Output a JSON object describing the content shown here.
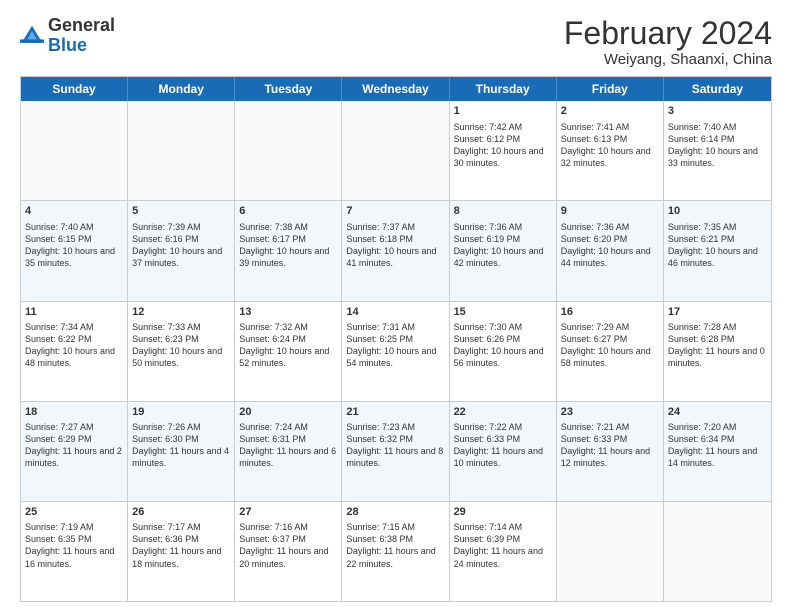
{
  "header": {
    "logo": {
      "general": "General",
      "blue": "Blue"
    },
    "title": "February 2024",
    "location": "Weiyang, Shaanxi, China"
  },
  "days_of_week": [
    "Sunday",
    "Monday",
    "Tuesday",
    "Wednesday",
    "Thursday",
    "Friday",
    "Saturday"
  ],
  "weeks": [
    {
      "alt": false,
      "cells": [
        {
          "day": "",
          "info": ""
        },
        {
          "day": "",
          "info": ""
        },
        {
          "day": "",
          "info": ""
        },
        {
          "day": "",
          "info": ""
        },
        {
          "day": "1",
          "info": "Sunrise: 7:42 AM\nSunset: 6:12 PM\nDaylight: 10 hours and 30 minutes."
        },
        {
          "day": "2",
          "info": "Sunrise: 7:41 AM\nSunset: 6:13 PM\nDaylight: 10 hours and 32 minutes."
        },
        {
          "day": "3",
          "info": "Sunrise: 7:40 AM\nSunset: 6:14 PM\nDaylight: 10 hours and 33 minutes."
        }
      ]
    },
    {
      "alt": true,
      "cells": [
        {
          "day": "4",
          "info": "Sunrise: 7:40 AM\nSunset: 6:15 PM\nDaylight: 10 hours and 35 minutes."
        },
        {
          "day": "5",
          "info": "Sunrise: 7:39 AM\nSunset: 6:16 PM\nDaylight: 10 hours and 37 minutes."
        },
        {
          "day": "6",
          "info": "Sunrise: 7:38 AM\nSunset: 6:17 PM\nDaylight: 10 hours and 39 minutes."
        },
        {
          "day": "7",
          "info": "Sunrise: 7:37 AM\nSunset: 6:18 PM\nDaylight: 10 hours and 41 minutes."
        },
        {
          "day": "8",
          "info": "Sunrise: 7:36 AM\nSunset: 6:19 PM\nDaylight: 10 hours and 42 minutes."
        },
        {
          "day": "9",
          "info": "Sunrise: 7:36 AM\nSunset: 6:20 PM\nDaylight: 10 hours and 44 minutes."
        },
        {
          "day": "10",
          "info": "Sunrise: 7:35 AM\nSunset: 6:21 PM\nDaylight: 10 hours and 46 minutes."
        }
      ]
    },
    {
      "alt": false,
      "cells": [
        {
          "day": "11",
          "info": "Sunrise: 7:34 AM\nSunset: 6:22 PM\nDaylight: 10 hours and 48 minutes."
        },
        {
          "day": "12",
          "info": "Sunrise: 7:33 AM\nSunset: 6:23 PM\nDaylight: 10 hours and 50 minutes."
        },
        {
          "day": "13",
          "info": "Sunrise: 7:32 AM\nSunset: 6:24 PM\nDaylight: 10 hours and 52 minutes."
        },
        {
          "day": "14",
          "info": "Sunrise: 7:31 AM\nSunset: 6:25 PM\nDaylight: 10 hours and 54 minutes."
        },
        {
          "day": "15",
          "info": "Sunrise: 7:30 AM\nSunset: 6:26 PM\nDaylight: 10 hours and 56 minutes."
        },
        {
          "day": "16",
          "info": "Sunrise: 7:29 AM\nSunset: 6:27 PM\nDaylight: 10 hours and 58 minutes."
        },
        {
          "day": "17",
          "info": "Sunrise: 7:28 AM\nSunset: 6:28 PM\nDaylight: 11 hours and 0 minutes."
        }
      ]
    },
    {
      "alt": true,
      "cells": [
        {
          "day": "18",
          "info": "Sunrise: 7:27 AM\nSunset: 6:29 PM\nDaylight: 11 hours and 2 minutes."
        },
        {
          "day": "19",
          "info": "Sunrise: 7:26 AM\nSunset: 6:30 PM\nDaylight: 11 hours and 4 minutes."
        },
        {
          "day": "20",
          "info": "Sunrise: 7:24 AM\nSunset: 6:31 PM\nDaylight: 11 hours and 6 minutes."
        },
        {
          "day": "21",
          "info": "Sunrise: 7:23 AM\nSunset: 6:32 PM\nDaylight: 11 hours and 8 minutes."
        },
        {
          "day": "22",
          "info": "Sunrise: 7:22 AM\nSunset: 6:33 PM\nDaylight: 11 hours and 10 minutes."
        },
        {
          "day": "23",
          "info": "Sunrise: 7:21 AM\nSunset: 6:33 PM\nDaylight: 11 hours and 12 minutes."
        },
        {
          "day": "24",
          "info": "Sunrise: 7:20 AM\nSunset: 6:34 PM\nDaylight: 11 hours and 14 minutes."
        }
      ]
    },
    {
      "alt": false,
      "cells": [
        {
          "day": "25",
          "info": "Sunrise: 7:19 AM\nSunset: 6:35 PM\nDaylight: 11 hours and 16 minutes."
        },
        {
          "day": "26",
          "info": "Sunrise: 7:17 AM\nSunset: 6:36 PM\nDaylight: 11 hours and 18 minutes."
        },
        {
          "day": "27",
          "info": "Sunrise: 7:16 AM\nSunset: 6:37 PM\nDaylight: 11 hours and 20 minutes."
        },
        {
          "day": "28",
          "info": "Sunrise: 7:15 AM\nSunset: 6:38 PM\nDaylight: 11 hours and 22 minutes."
        },
        {
          "day": "29",
          "info": "Sunrise: 7:14 AM\nSunset: 6:39 PM\nDaylight: 11 hours and 24 minutes."
        },
        {
          "day": "",
          "info": ""
        },
        {
          "day": "",
          "info": ""
        }
      ]
    }
  ]
}
